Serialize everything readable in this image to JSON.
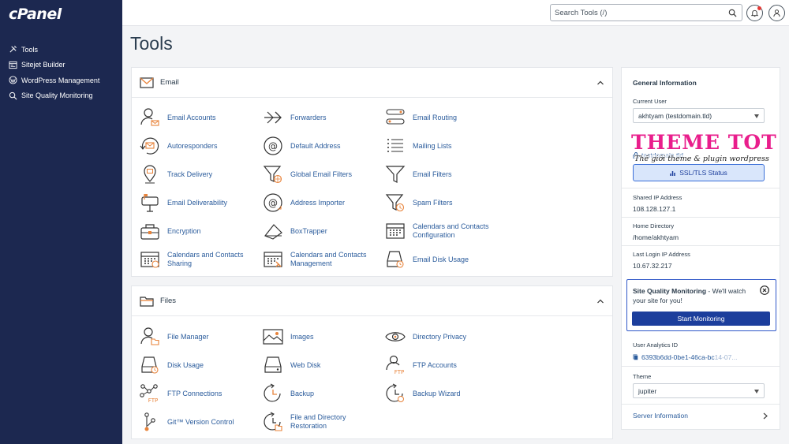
{
  "app": {
    "logo": "cPanel"
  },
  "sidebar": {
    "items": [
      {
        "label": "Tools"
      },
      {
        "label": "Sitejet Builder"
      },
      {
        "label": "WordPress Management"
      },
      {
        "label": "Site Quality Monitoring"
      }
    ]
  },
  "search": {
    "placeholder": "Search Tools (/)"
  },
  "page": {
    "title": "Tools"
  },
  "email": {
    "title": "Email",
    "tools": [
      {
        "label": "Email Accounts",
        "icon": "email-accounts-icon"
      },
      {
        "label": "Forwarders",
        "icon": "forwarders-icon"
      },
      {
        "label": "Email Routing",
        "icon": "email-routing-icon"
      },
      {
        "label": "Autoresponders",
        "icon": "autoresponders-icon"
      },
      {
        "label": "Default Address",
        "icon": "default-address-icon"
      },
      {
        "label": "Mailing Lists",
        "icon": "mailing-lists-icon"
      },
      {
        "label": "Track Delivery",
        "icon": "track-delivery-icon"
      },
      {
        "label": "Global Email Filters",
        "icon": "global-filter-icon"
      },
      {
        "label": "Email Filters",
        "icon": "email-filters-icon"
      },
      {
        "label": "Email Deliverability",
        "icon": "email-deliverability-icon"
      },
      {
        "label": "Address Importer",
        "icon": "address-importer-icon"
      },
      {
        "label": "Spam Filters",
        "icon": "spam-filters-icon"
      },
      {
        "label": "Encryption",
        "icon": "encryption-icon"
      },
      {
        "label": "BoxTrapper",
        "icon": "boxtrapper-icon"
      },
      {
        "label": "Calendars and Contacts Configuration",
        "icon": "calendar-config-icon"
      },
      {
        "label": "Calendars and Contacts Sharing",
        "icon": "calendar-sharing-icon"
      },
      {
        "label": "Calendars and Contacts Management",
        "icon": "calendar-management-icon"
      },
      {
        "label": "Email Disk Usage",
        "icon": "email-disk-usage-icon"
      }
    ]
  },
  "files": {
    "title": "Files",
    "tools": [
      {
        "label": "File Manager",
        "icon": "file-manager-icon"
      },
      {
        "label": "Images",
        "icon": "images-icon"
      },
      {
        "label": "Directory Privacy",
        "icon": "directory-privacy-icon"
      },
      {
        "label": "Disk Usage",
        "icon": "disk-usage-icon"
      },
      {
        "label": "Web Disk",
        "icon": "web-disk-icon"
      },
      {
        "label": "FTP Accounts",
        "icon": "ftp-accounts-icon"
      },
      {
        "label": "FTP Connections",
        "icon": "ftp-connections-icon"
      },
      {
        "label": "Backup",
        "icon": "backup-icon"
      },
      {
        "label": "Backup Wizard",
        "icon": "backup-wizard-icon"
      },
      {
        "label": "Git™ Version Control",
        "icon": "git-icon"
      },
      {
        "label": "File and Directory Restoration",
        "icon": "restoration-icon"
      }
    ]
  },
  "info": {
    "title": "General Information",
    "current_user_label": "Current User",
    "current_user": "akhtyam (testdomain.tld)",
    "domain": "testdomain.tld",
    "ssl_button": "SSL/TLS Status",
    "shared_ip_label": "Shared IP Address",
    "shared_ip": "108.128.127.1",
    "home_dir_label": "Home Directory",
    "home_dir": "/home/akhtyam",
    "last_login_label": "Last Login IP Address",
    "last_login": "10.67.32.217",
    "sqm_title": "Site Quality Monitoring",
    "sqm_text": " - We'll watch your site for you!",
    "sqm_button": "Start Monitoring",
    "analytics_label": "User Analytics ID",
    "analytics_id": "6393b6dd-0be1-46ca-bc",
    "analytics_id_fade": "14-07...",
    "theme_label": "Theme",
    "theme": "jupiter",
    "server_info": "Server Information"
  },
  "watermark": {
    "title": "THEME TOT",
    "subtitle": "Thế giới theme & plugin wordpress"
  },
  "colors": {
    "sidebar": "#1c2850",
    "link": "#2b5c9c",
    "accent": "#e8833a",
    "primary": "#1c3e9c"
  }
}
